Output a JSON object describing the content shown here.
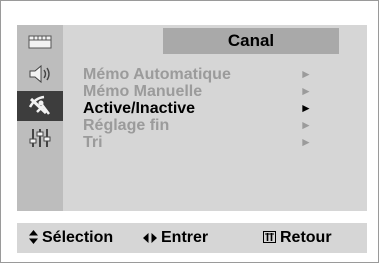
{
  "menu": {
    "title": "Canal",
    "items": [
      {
        "label": "Mémo Automatique",
        "arrow": "►",
        "selected": false
      },
      {
        "label": "Mémo Manuelle",
        "arrow": "►",
        "selected": false
      },
      {
        "label": "Active/Inactive",
        "arrow": "►",
        "selected": true
      },
      {
        "label": "Réglage fin",
        "arrow": "►",
        "selected": false
      },
      {
        "label": "Tri",
        "arrow": "►",
        "selected": false
      }
    ]
  },
  "sidebar": {
    "icons": [
      "input-icon",
      "sound-icon",
      "channel-antenna-icon",
      "setup-sliders-icon"
    ],
    "active_index": 2
  },
  "footer": {
    "select_icon": "▲▼",
    "select_label": "Sélection",
    "enter_icon": "◆",
    "enter_label": "Entrer",
    "return_icon": "Ⅲ",
    "return_label": "Retour"
  },
  "colors": {
    "panel": "#d6d6d6",
    "sidebar": "#bdbdbd",
    "title_tab": "#a9a9a9",
    "active_icon_bg": "#3d3d3d",
    "disabled_text": "#9b9b9b",
    "selected_text": "#000000"
  }
}
